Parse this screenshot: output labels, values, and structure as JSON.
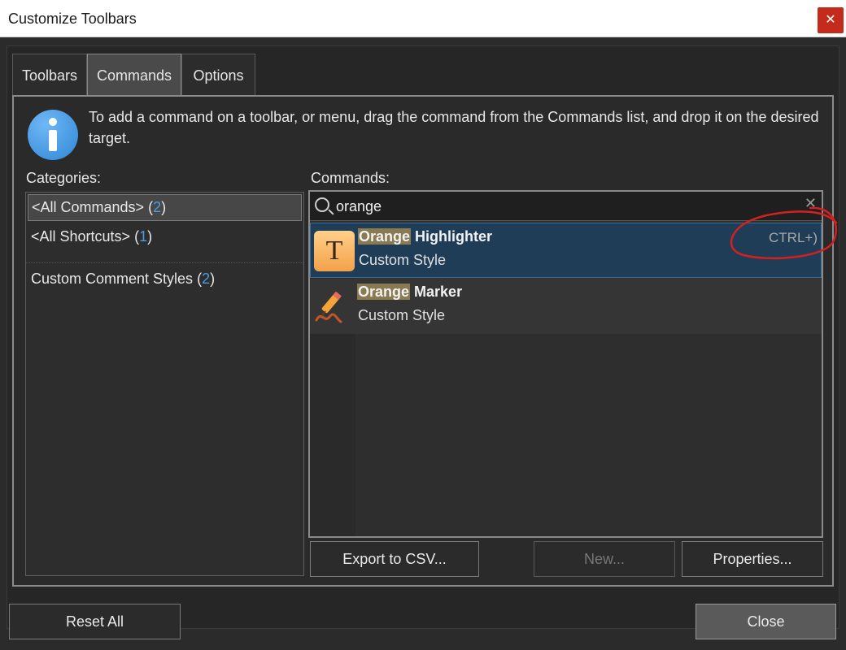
{
  "window": {
    "title": "Customize Toolbars",
    "close_glyph": "✕"
  },
  "tabs": [
    {
      "label": "Toolbars"
    },
    {
      "label": "Commands",
      "active": true
    },
    {
      "label": "Options"
    }
  ],
  "info": {
    "icon": "info-icon",
    "text": "To add a command on a toolbar, or menu, drag the command from the Commands list, and drop it on the desired target."
  },
  "categories": {
    "label": "Categories:",
    "items": [
      {
        "name": "<All Commands>",
        "count": "2",
        "selected": true
      },
      {
        "name": "<All Shortcuts>",
        "count": "1"
      },
      {
        "name": "Custom Comment Styles",
        "count": "2"
      }
    ]
  },
  "commands": {
    "label": "Commands:",
    "search": {
      "value": "orange",
      "clear_glyph": "✕"
    },
    "items": [
      {
        "highlight": "Orange",
        "name_rest": " Highlighter",
        "subtitle": "Custom Style",
        "shortcut": "CTRL+)",
        "icon": "text-highlighter-icon",
        "selected": true
      },
      {
        "highlight": "Orange",
        "name_rest": " Marker",
        "subtitle": "Custom Style",
        "icon": "pencil-marker-icon"
      }
    ]
  },
  "buttons": {
    "export": "Export to CSV...",
    "new": "New...",
    "properties": "Properties...",
    "reset_all": "Reset All",
    "close": "Close"
  },
  "colors": {
    "accent_count": "#4d9be0",
    "selection": "#1f3d57",
    "search_highlight": "#8a7a52",
    "annotation": "#d42020"
  }
}
